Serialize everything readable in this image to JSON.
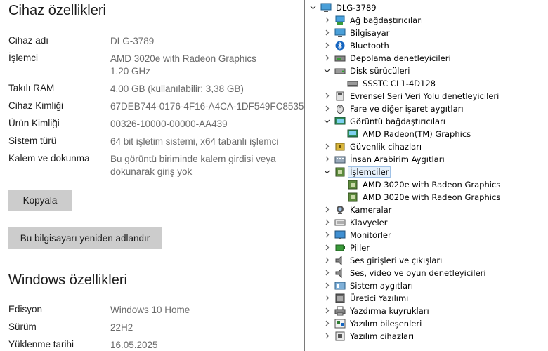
{
  "device_specs": {
    "title": "Cihaz özellikleri",
    "rows": [
      {
        "label": "Cihaz adı",
        "value": "DLG-3789"
      },
      {
        "label": "İşlemci",
        "value": "AMD 3020e with Radeon Graphics",
        "value2": "1.20 GHz"
      },
      {
        "label": "Takılı RAM",
        "value": "4,00 GB (kullanılabilir: 3,38 GB)"
      },
      {
        "label": "Cihaz Kimliği",
        "value": "67DEB744-0176-4F16-A4CA-1DF549FC8535"
      },
      {
        "label": "Ürün Kimliği",
        "value": "00326-10000-00000-AA439"
      },
      {
        "label": "Sistem türü",
        "value": "64 bit işletim sistemi, x64 tabanlı işlemci"
      },
      {
        "label": "Kalem ve dokunma",
        "value": "Bu görüntü biriminde kalem girdisi veya",
        "value2": "dokunarak giriş yok"
      }
    ],
    "copy_button": "Kopyala",
    "rename_button": "Bu bilgisayarı yeniden adlandır"
  },
  "windows_specs": {
    "title": "Windows özellikleri",
    "rows": [
      {
        "label": "Edisyon",
        "value": "Windows 10 Home"
      },
      {
        "label": "Sürüm",
        "value": "22H2"
      },
      {
        "label": "Yüklenme tarihi",
        "value": "16.05.2025"
      }
    ]
  },
  "device_tree": {
    "root": "DLG-3789",
    "items": [
      {
        "label": "Ağ bağdaştırıcıları",
        "icon": "network-adapter-icon",
        "level": 1,
        "state": "collapsed"
      },
      {
        "label": "Bilgisayar",
        "icon": "computer-icon",
        "level": 1,
        "state": "collapsed"
      },
      {
        "label": "Bluetooth",
        "icon": "bluetooth-icon",
        "level": 1,
        "state": "collapsed"
      },
      {
        "label": "Depolama denetleyicileri",
        "icon": "storage-controller-icon",
        "level": 1,
        "state": "collapsed"
      },
      {
        "label": "Disk sürücüleri",
        "icon": "disk-drive-icon",
        "level": 1,
        "state": "expanded"
      },
      {
        "label": "SSSTC CL1-4D128",
        "icon": "disk-icon",
        "level": 2,
        "state": "leaf"
      },
      {
        "label": "Evrensel Seri Veri Yolu denetleyicileri",
        "icon": "usb-icon",
        "level": 1,
        "state": "collapsed"
      },
      {
        "label": "Fare ve diğer işaret aygıtları",
        "icon": "mouse-icon",
        "level": 1,
        "state": "collapsed"
      },
      {
        "label": "Görüntü bağdaştırıcıları",
        "icon": "display-adapter-icon",
        "level": 1,
        "state": "expanded"
      },
      {
        "label": "AMD Radeon(TM) Graphics",
        "icon": "display-adapter-icon",
        "level": 2,
        "state": "leaf"
      },
      {
        "label": "Güvenlik cihazları",
        "icon": "security-device-icon",
        "level": 1,
        "state": "collapsed"
      },
      {
        "label": "İnsan Arabirim Aygıtları",
        "icon": "hid-icon",
        "level": 1,
        "state": "collapsed"
      },
      {
        "label": "İşlemciler",
        "icon": "processor-icon",
        "level": 1,
        "state": "expanded",
        "selected": true
      },
      {
        "label": "AMD 3020e with Radeon Graphics",
        "icon": "processor-icon",
        "level": 2,
        "state": "leaf"
      },
      {
        "label": "AMD 3020e with Radeon Graphics",
        "icon": "processor-icon",
        "level": 2,
        "state": "leaf"
      },
      {
        "label": "Kameralar",
        "icon": "camera-icon",
        "level": 1,
        "state": "collapsed"
      },
      {
        "label": "Klavyeler",
        "icon": "keyboard-icon",
        "level": 1,
        "state": "collapsed"
      },
      {
        "label": "Monitörler",
        "icon": "monitor-icon",
        "level": 1,
        "state": "collapsed"
      },
      {
        "label": "Piller",
        "icon": "battery-icon",
        "level": 1,
        "state": "collapsed"
      },
      {
        "label": "Ses girişleri ve çıkışları",
        "icon": "speaker-icon",
        "level": 1,
        "state": "collapsed"
      },
      {
        "label": "Ses, video ve oyun denetleyicileri",
        "icon": "speaker-icon",
        "level": 1,
        "state": "collapsed"
      },
      {
        "label": "Sistem aygıtları",
        "icon": "system-device-icon",
        "level": 1,
        "state": "collapsed"
      },
      {
        "label": "Üretici Yazılımı",
        "icon": "firmware-icon",
        "level": 1,
        "state": "collapsed"
      },
      {
        "label": "Yazdırma kuyrukları",
        "icon": "printer-icon",
        "level": 1,
        "state": "collapsed"
      },
      {
        "label": "Yazılım bileşenleri",
        "icon": "software-component-icon",
        "level": 1,
        "state": "collapsed"
      },
      {
        "label": "Yazılım cihazları",
        "icon": "software-device-icon",
        "level": 1,
        "state": "collapsed"
      }
    ]
  },
  "colors": {
    "selection_fill": "#e5f0fb",
    "selection_border": "#9fc1e6",
    "button_bg": "#cccccc",
    "value_text": "#6a6a6a"
  }
}
